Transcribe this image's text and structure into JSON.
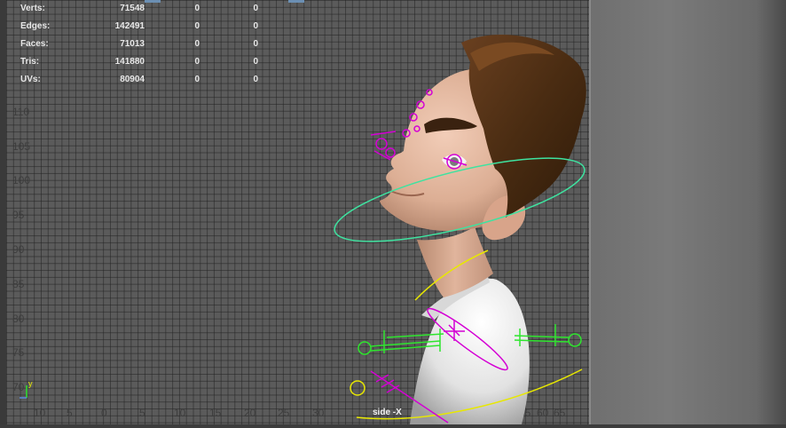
{
  "hud": {
    "rows": [
      {
        "label": "Verts:",
        "c1": "71548",
        "c2": "0",
        "c3": "0"
      },
      {
        "label": "Edges:",
        "c1": "142491",
        "c2": "0",
        "c3": "0"
      },
      {
        "label": "Faces:",
        "c1": "71013",
        "c2": "0",
        "c3": "0"
      },
      {
        "label": "Tris:",
        "c1": "141880",
        "c2": "0",
        "c3": "0"
      },
      {
        "label": "UVs:",
        "c1": "80904",
        "c2": "0",
        "c3": "0"
      }
    ]
  },
  "axis": {
    "vertical_ticks": [
      "110",
      "105",
      "100",
      "95",
      "90",
      "85",
      "80",
      "75",
      "70"
    ],
    "horizontal_ticks": [
      "10",
      "5",
      "0",
      "5",
      "10",
      "15",
      "20",
      "25",
      "30",
      "55",
      "60",
      "65"
    ],
    "indicator_label": "y"
  },
  "viewport": {
    "camera_name": "side -X"
  },
  "colors": {
    "grid_bg": "#5b5b5b",
    "hud_text": "#e8e8e8",
    "control_green": "#2ee52e",
    "control_yellow": "#e8e800",
    "control_magenta": "#d400d4",
    "control_cyan": "#3ee3a0",
    "skin": "#e3b8a0",
    "hair": "#4a2c12",
    "shirt": "#e8e8e8"
  }
}
